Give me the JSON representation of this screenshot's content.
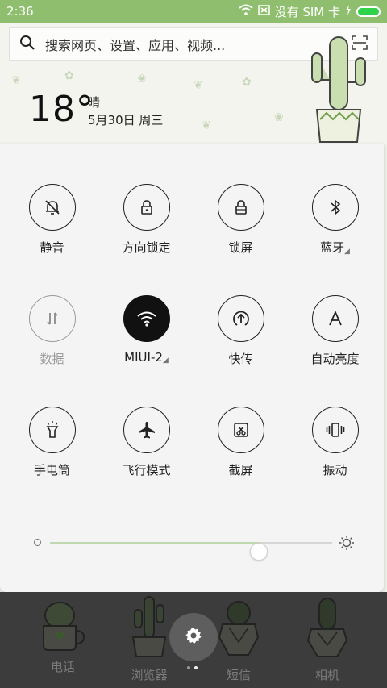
{
  "status_bar": {
    "time": "2:36",
    "no_sim": "没有 SIM 卡",
    "battery_level": 1.0
  },
  "search": {
    "placeholder": "搜索网页、设置、应用、视频..."
  },
  "weather": {
    "temperature": "18°",
    "condition": "晴",
    "date": "5月30日 周三"
  },
  "quick_settings": {
    "tiles": [
      {
        "label": "静音",
        "icon": "bell-mute-icon"
      },
      {
        "label": "方向锁定",
        "icon": "lock-rotation-icon"
      },
      {
        "label": "锁屏",
        "icon": "lock-icon"
      },
      {
        "label": "蓝牙",
        "icon": "bluetooth-icon"
      },
      {
        "label": "数据",
        "icon": "mobile-data-icon"
      },
      {
        "label": "MIUI-2",
        "icon": "wifi-icon"
      },
      {
        "label": "快传",
        "icon": "transfer-icon"
      },
      {
        "label": "自动亮度",
        "icon": "auto-brightness-icon"
      },
      {
        "label": "手电筒",
        "icon": "flashlight-icon"
      },
      {
        "label": "飞行模式",
        "icon": "airplane-icon"
      },
      {
        "label": "截屏",
        "icon": "screenshot-icon"
      },
      {
        "label": "振动",
        "icon": "vibrate-icon"
      }
    ],
    "brightness": 0.74
  },
  "dock": {
    "apps": [
      {
        "label": "电话",
        "icon": "phone-cactus-icon"
      },
      {
        "label": "浏览器",
        "icon": "browser-cactus-icon"
      },
      {
        "label": "短信",
        "icon": "messages-cactus-icon"
      },
      {
        "label": "相机",
        "icon": "camera-cactus-icon"
      }
    ]
  },
  "colors": {
    "status_bar": "#8fbf6e",
    "battery": "#2fd24a",
    "tile_active": "#111111",
    "panel": "#f4f4f4"
  }
}
